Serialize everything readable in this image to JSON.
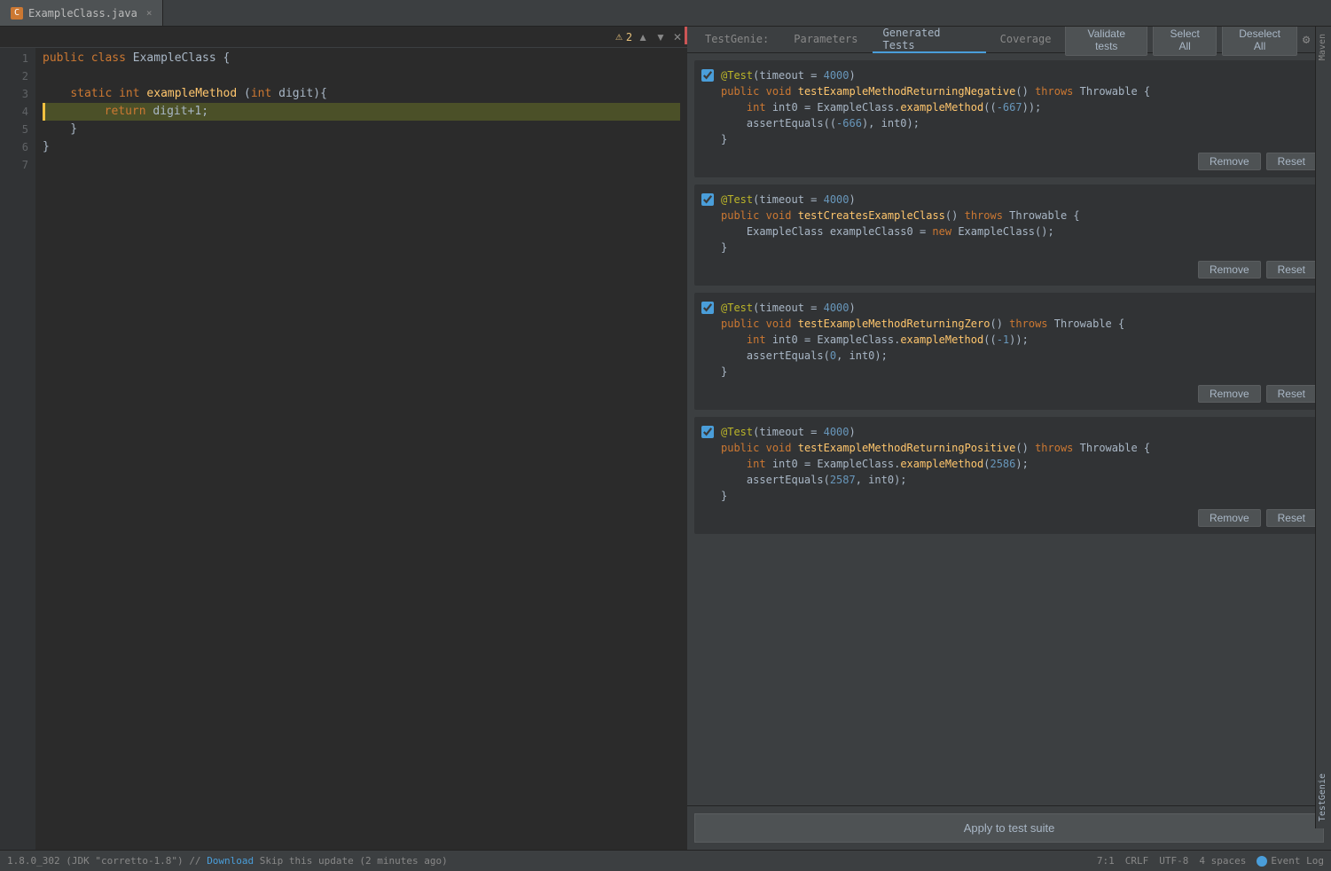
{
  "tab": {
    "filename": "ExampleClass.java",
    "icon_char": "C"
  },
  "editor": {
    "warning_count": "⚠ 2",
    "lines": [
      {
        "num": 1,
        "content": "public class ExampleClass {",
        "type": "normal"
      },
      {
        "num": 2,
        "content": "",
        "type": "normal"
      },
      {
        "num": 3,
        "content": "    static int exampleMethod (int digit){",
        "type": "normal"
      },
      {
        "num": 4,
        "content": "        return digit+1;",
        "type": "highlighted"
      },
      {
        "num": 5,
        "content": "    }",
        "type": "normal"
      },
      {
        "num": 6,
        "content": "}",
        "type": "normal"
      },
      {
        "num": 7,
        "content": "",
        "type": "normal"
      }
    ]
  },
  "testgenie": {
    "tabs": [
      {
        "id": "testgenie",
        "label": "TestGenie:"
      },
      {
        "id": "parameters",
        "label": "Parameters"
      },
      {
        "id": "generated-tests",
        "label": "Generated Tests"
      },
      {
        "id": "coverage",
        "label": "Coverage"
      }
    ],
    "buttons": {
      "validate": "Validate tests",
      "select_all": "Select All",
      "deselect_all": "Deselect All"
    },
    "tests": [
      {
        "id": "test1",
        "checked": true,
        "lines": [
          "@Test(timeout = 4000)",
          "public void testExampleMethodReturningNegative() throws Throwable {",
          "    int int0 = ExampleClass.exampleMethod((-667));",
          "    assertEquals((-666), int0);",
          "}"
        ],
        "remove_label": "Remove",
        "reset_label": "Reset"
      },
      {
        "id": "test2",
        "checked": true,
        "lines": [
          "@Test(timeout = 4000)",
          "public void testCreatesExampleClass() throws Throwable {",
          "    ExampleClass exampleClass0 = new ExampleClass();",
          "}"
        ],
        "remove_label": "Remove",
        "reset_label": "Reset"
      },
      {
        "id": "test3",
        "checked": true,
        "lines": [
          "@Test(timeout = 4000)",
          "public void testExampleMethodReturningZero() throws Throwable {",
          "    int int0 = ExampleClass.exampleMethod((-1));",
          "    assertEquals(0, int0);",
          "}"
        ],
        "remove_label": "Remove",
        "reset_label": "Reset"
      },
      {
        "id": "test4",
        "checked": true,
        "lines": [
          "@Test(timeout = 4000)",
          "public void testExampleMethodReturningPositive() throws Throwable {",
          "    int int0 = ExampleClass.exampleMethod(2586);",
          "    assertEquals(2587, int0);",
          "}"
        ],
        "remove_label": "Remove",
        "reset_label": "Reset"
      }
    ],
    "apply_label": "Apply to test suite",
    "side_tabs": [
      "Maven",
      "TestGenie"
    ]
  },
  "status_bar": {
    "sdk": "1.8.0_302 (JDK \"corretto-1.8\")",
    "download": "Download",
    "skip_label": "Skip this update (2 minutes ago)",
    "position": "7:1",
    "line_ending": "CRLF",
    "encoding": "UTF-8",
    "indent": "4 spaces",
    "event_log": "Event Log"
  }
}
